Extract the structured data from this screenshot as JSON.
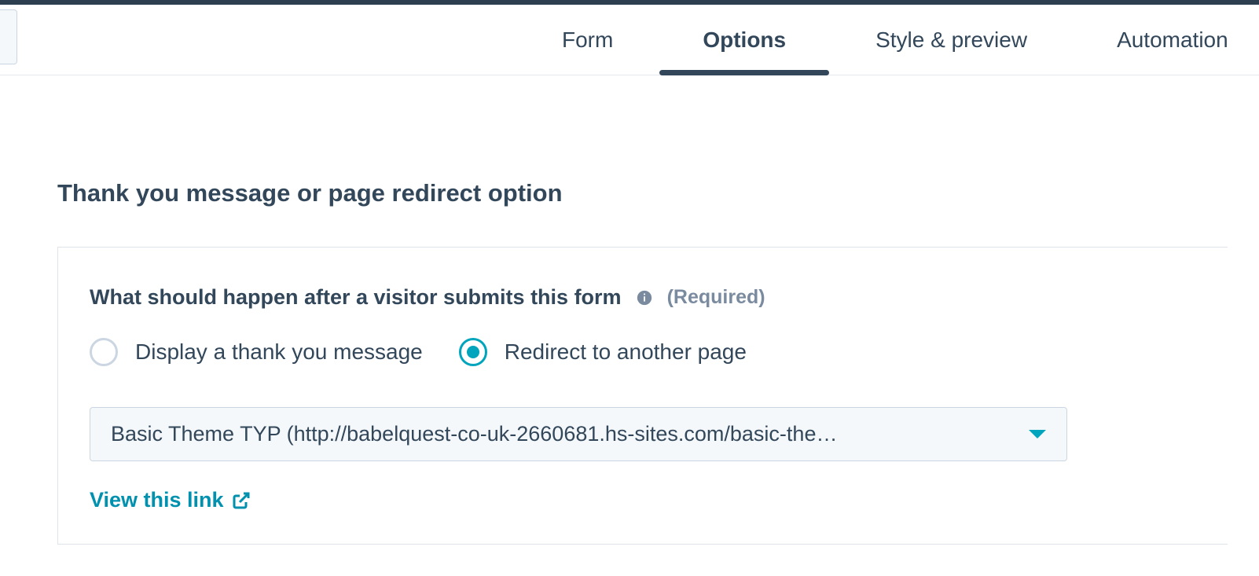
{
  "tabs": {
    "form": "Form",
    "options": "Options",
    "style_preview": "Style & preview",
    "automation": "Automation"
  },
  "section": {
    "title": "Thank you message or page redirect option",
    "field_label": "What should happen after a visitor submits this form",
    "required_label": "(Required)"
  },
  "radios": {
    "display_msg": "Display a thank you message",
    "redirect": "Redirect to another page"
  },
  "select": {
    "value": "Basic Theme TYP (http://babelquest-co-uk-2660681.hs-sites.com/basic-the…"
  },
  "link": {
    "label": "View this link"
  }
}
